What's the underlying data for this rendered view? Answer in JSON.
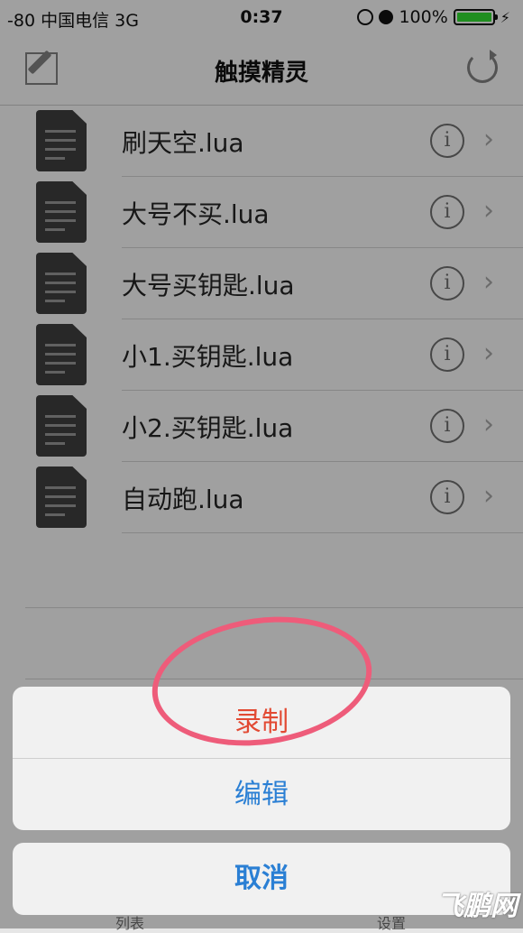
{
  "status_bar": {
    "signal": "-80",
    "carrier": "中国电信",
    "network": "3G",
    "time": "0:37",
    "battery": "100%"
  },
  "nav": {
    "title": "触摸精灵"
  },
  "files": [
    {
      "name": "刷天空.lua"
    },
    {
      "name": "大号不买.lua"
    },
    {
      "name": "大号买钥匙.lua"
    },
    {
      "name": "小1.买钥匙.lua"
    },
    {
      "name": "小2.买钥匙.lua"
    },
    {
      "name": "自动跑.lua"
    }
  ],
  "action_sheet": {
    "record_label": "录制",
    "edit_label": "编辑",
    "cancel_label": "取消"
  },
  "tab_bar": {
    "list_label": "列表",
    "settings_label": "设置"
  },
  "watermark": "飞鹏网",
  "colors": {
    "record": "#e24a33",
    "action": "#2a7fd4",
    "annotation_circle": "#ee5c7a",
    "battery": "#2ecc2e"
  }
}
